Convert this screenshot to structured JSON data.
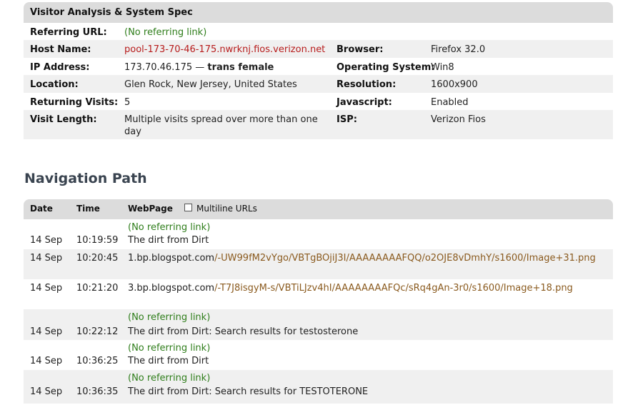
{
  "spec": {
    "title": "Visitor Analysis & System Spec",
    "rows": [
      {
        "l1": "Referring URL:",
        "v1": "(No referring link)",
        "l2": "",
        "v2": ""
      },
      {
        "l1": "Host Name:",
        "v1": "pool-173-70-46-175.nwrknj.fios.verizon.net",
        "l2": "Browser:",
        "v2": "Firefox 32.0"
      },
      {
        "l1": "IP Address:",
        "v1": "173.70.46.175 —",
        "v1b": "trans female",
        "l2": "Operating System:",
        "v2": "Win8"
      },
      {
        "l1": "Location:",
        "v1": "Glen Rock, New Jersey, United States",
        "l2": "Resolution:",
        "v2": "1600x900"
      },
      {
        "l1": "Returning Visits:",
        "v1": "5",
        "l2": "Javascript:",
        "v2": "Enabled"
      },
      {
        "l1": "Visit Length:",
        "v1": "Multiple visits spread over more than one day",
        "l2": "ISP:",
        "v2": "Verizon Fios"
      }
    ]
  },
  "nav": {
    "title": "Navigation Path",
    "headers": {
      "date": "Date",
      "time": "Time",
      "webpage": "WebPage",
      "multiline": "Multiline URLs"
    },
    "rows": [
      {
        "date": "14 Sep",
        "time": "10:19:59",
        "ref": "(No referring link)",
        "page": "The dirt from Dirt"
      },
      {
        "date": "14 Sep",
        "time": "10:20:45",
        "url_domain": "1.bp.blogspot.com",
        "url_path": "/-UW99fM2vYgo/VBTgBOjiJ3I/AAAAAAAAFQQ/o2OJE8vDmhY/s1600/Image+31.png"
      },
      {
        "date": "14 Sep",
        "time": "10:21:20",
        "url_domain": "3.bp.blogspot.com",
        "url_path": "/-T7J8isgyM-s/VBTiLJzv4hI/AAAAAAAAFQc/sRq4gAn-3r0/s1600/Image+18.png"
      },
      {
        "date": "14 Sep",
        "time": "10:22:12",
        "ref": "(No referring link)",
        "page": "The dirt from Dirt: Search results for testosterone"
      },
      {
        "date": "14 Sep",
        "time": "10:36:25",
        "ref": "(No referring link)",
        "page": "The dirt from Dirt"
      },
      {
        "date": "14 Sep",
        "time": "10:36:35",
        "ref": "(No referring link)",
        "page": "The dirt from Dirt: Search results for TESTOTERONE"
      }
    ]
  }
}
